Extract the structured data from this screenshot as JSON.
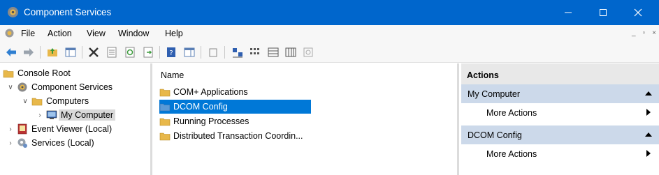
{
  "window": {
    "title": "Component Services"
  },
  "menu": [
    "File",
    "Action",
    "View",
    "Window",
    "Help"
  ],
  "mdi_buttons": [
    "_",
    "▫",
    "×"
  ],
  "tree": {
    "items": [
      {
        "label": "Console Root"
      },
      {
        "label": "Component Services"
      },
      {
        "label": "Computers"
      },
      {
        "label": "My Computer"
      },
      {
        "label": "Event Viewer (Local)"
      },
      {
        "label": "Services (Local)"
      }
    ]
  },
  "list": {
    "header": "Name",
    "items": [
      {
        "label": "COM+ Applications"
      },
      {
        "label": "DCOM Config"
      },
      {
        "label": "Running Processes"
      },
      {
        "label": "Distributed Transaction Coordin..."
      }
    ]
  },
  "actions": {
    "header": "Actions",
    "sections": [
      {
        "title": "My Computer",
        "item": "More Actions"
      },
      {
        "title": "DCOM Config",
        "item": "More Actions"
      }
    ]
  },
  "colors": {
    "titlebar": "#0066cc",
    "selection": "#0078d7",
    "action_section": "#ccd9ea",
    "folder": "#e8b84a"
  }
}
